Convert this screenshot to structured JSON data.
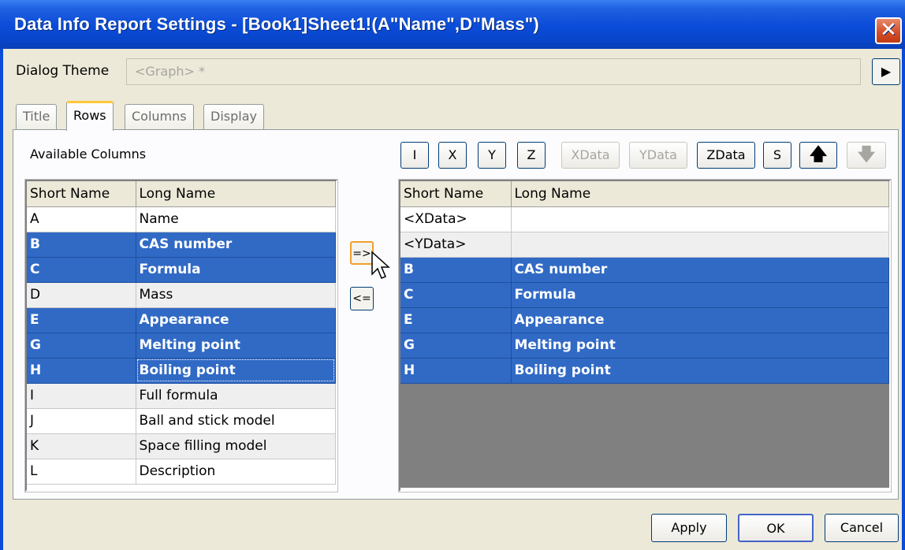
{
  "window": {
    "title": "Data Info Report Settings - [Book1]Sheet1!(A\"Name\",D\"Mass\")",
    "close_glyph": "✕"
  },
  "dialog_theme": {
    "label": "Dialog Theme",
    "value": "<Graph> *",
    "arrow_glyph": "▶"
  },
  "tabs": [
    {
      "label": "Title"
    },
    {
      "label": "Rows"
    },
    {
      "label": "Columns"
    },
    {
      "label": "Display"
    }
  ],
  "active_tab": "Rows",
  "available": {
    "label": "Available Columns",
    "headers": [
      "Short Name",
      "Long Name"
    ],
    "rows": [
      {
        "short": "A",
        "long": "Name",
        "selected": false
      },
      {
        "short": "B",
        "long": "CAS number",
        "selected": true
      },
      {
        "short": "C",
        "long": "Formula",
        "selected": true
      },
      {
        "short": "D",
        "long": "Mass",
        "selected": false
      },
      {
        "short": "E",
        "long": "Appearance",
        "selected": true
      },
      {
        "short": "G",
        "long": "Melting point",
        "selected": true
      },
      {
        "short": "H",
        "long": "Boiling point",
        "selected": true
      },
      {
        "short": "I",
        "long": "Full formula",
        "selected": false
      },
      {
        "short": "J",
        "long": "Ball and stick model",
        "selected": false
      },
      {
        "short": "K",
        "long": "Space filling model",
        "selected": false
      },
      {
        "short": "L",
        "long": "Description",
        "selected": false
      }
    ]
  },
  "move_buttons": {
    "add": "=>",
    "remove": "<="
  },
  "toolbar": {
    "buttons": [
      {
        "label": "I",
        "enabled": true
      },
      {
        "label": "X",
        "enabled": true
      },
      {
        "label": "Y",
        "enabled": true
      },
      {
        "label": "Z",
        "enabled": true
      },
      {
        "label": "XData",
        "enabled": false
      },
      {
        "label": "YData",
        "enabled": false
      },
      {
        "label": "ZData",
        "enabled": true
      },
      {
        "label": "S",
        "enabled": true
      },
      {
        "label": "🡅",
        "enabled": true,
        "icon": "arrow-up-icon"
      },
      {
        "label": "🡇",
        "enabled": false,
        "icon": "arrow-down-icon"
      }
    ]
  },
  "selected": {
    "headers": [
      "Short Name",
      "Long Name"
    ],
    "rows": [
      {
        "short": "<XData>",
        "long": "",
        "selected": false
      },
      {
        "short": "<YData>",
        "long": "",
        "selected": false
      },
      {
        "short": "B",
        "long": "CAS number",
        "selected": true
      },
      {
        "short": "C",
        "long": "Formula",
        "selected": true
      },
      {
        "short": "E",
        "long": "Appearance",
        "selected": true
      },
      {
        "short": "G",
        "long": "Melting point",
        "selected": true
      },
      {
        "short": "H",
        "long": "Boiling point",
        "selected": true
      }
    ]
  },
  "buttons": {
    "apply": "Apply",
    "ok": "OK",
    "cancel": "Cancel"
  },
  "colors": {
    "selection": "#316ac5",
    "titlebar": "#0a4bd8",
    "dialog_bg": "#ece9d8",
    "empty_area": "#808080"
  }
}
